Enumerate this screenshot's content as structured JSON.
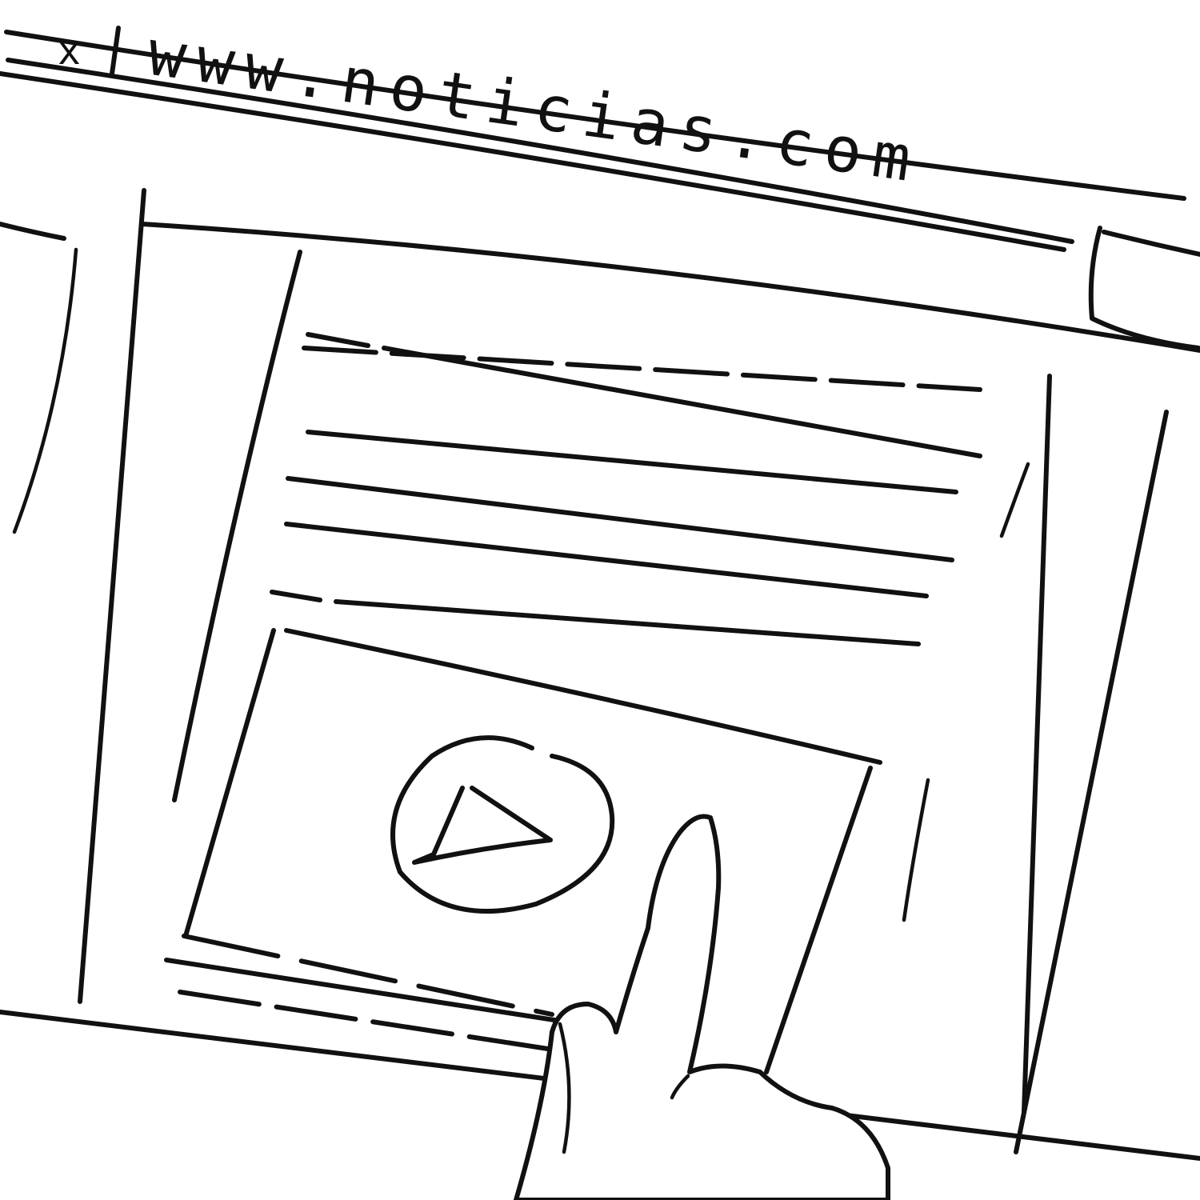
{
  "browser": {
    "close_label": "x",
    "url": "www.noticias.com"
  },
  "icons": {
    "close": "close-icon",
    "play": "play-icon"
  },
  "colors": {
    "ink": "#111111",
    "paper": "#ffffff"
  }
}
